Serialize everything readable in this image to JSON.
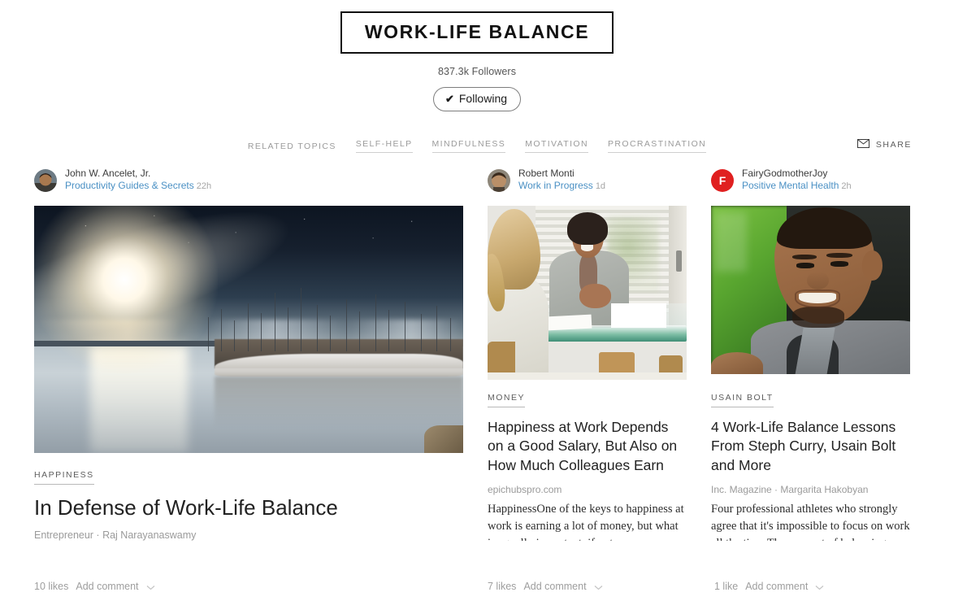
{
  "header": {
    "title": "WORK-LIFE BALANCE",
    "followers": "837.3k Followers",
    "follow_button": {
      "label": "Following",
      "check_glyph": "✔",
      "state": "following"
    }
  },
  "topics": {
    "label": "RELATED TOPICS",
    "items": [
      {
        "label": "SELF-HELP"
      },
      {
        "label": "MINDFULNESS"
      },
      {
        "label": "MOTIVATION"
      },
      {
        "label": "PROCRASTINATION"
      }
    ]
  },
  "share": {
    "label": "SHARE",
    "icon": "envelope-icon"
  },
  "colors": {
    "magazine_link": "#4a90c4",
    "avatar_red": "#e02020",
    "text_primary": "#222222",
    "text_muted": "#9e9e9e"
  },
  "cards": [
    {
      "author": {
        "name": "John W. Ancelet, Jr.",
        "avatar_type": "photo"
      },
      "magazine": "Productivity Guides & Secrets",
      "time": "22h",
      "image": {
        "alt": "marina at sunrise with sailboats and reflecting water",
        "style": "marina"
      },
      "topic_tag": "HAPPINESS",
      "headline": "In Defense of Work-Life Balance",
      "source": "Entrepreneur · Raj Narayanaswamy",
      "excerpt": "",
      "likes": "10 likes",
      "add_comment": "Add comment"
    },
    {
      "author": {
        "name": "Robert Monti",
        "avatar_type": "photo"
      },
      "magazine": "Work in Progress",
      "time": "1d",
      "image": {
        "alt": "two women meeting at a glass office table",
        "style": "office"
      },
      "topic_tag": "MONEY",
      "headline": "Happiness at Work Depends on a Good Salary, But Also on How Much Colleagues Earn",
      "source": "epichubspro.com",
      "excerpt": "HappinessOne of the keys to happiness at work is earning a lot of money, but what is equally important, if not more important, is that our earnings",
      "likes": "7 likes",
      "add_comment": "Add comment"
    },
    {
      "author": {
        "name": "FairyGodmotherJoy",
        "avatar_type": "initial",
        "initial": "F"
      },
      "magazine": "Positive Mental Health",
      "time": "2h",
      "image": {
        "alt": "smiling man in grey blazer in front of green backdrop",
        "style": "athlete"
      },
      "topic_tag": "USAIN BOLT",
      "headline": "4 Work-Life Balance Lessons From Steph Curry, Usain Bolt and More",
      "source": "Inc. Magazine · Margarita Hakobyan",
      "excerpt": "Four professional athletes who strongly agree that it's impossible to focus on work all the time.The concept of balancing work commitments and life or family commitments has become increasingly",
      "likes": "1 like",
      "add_comment": "Add comment"
    }
  ]
}
